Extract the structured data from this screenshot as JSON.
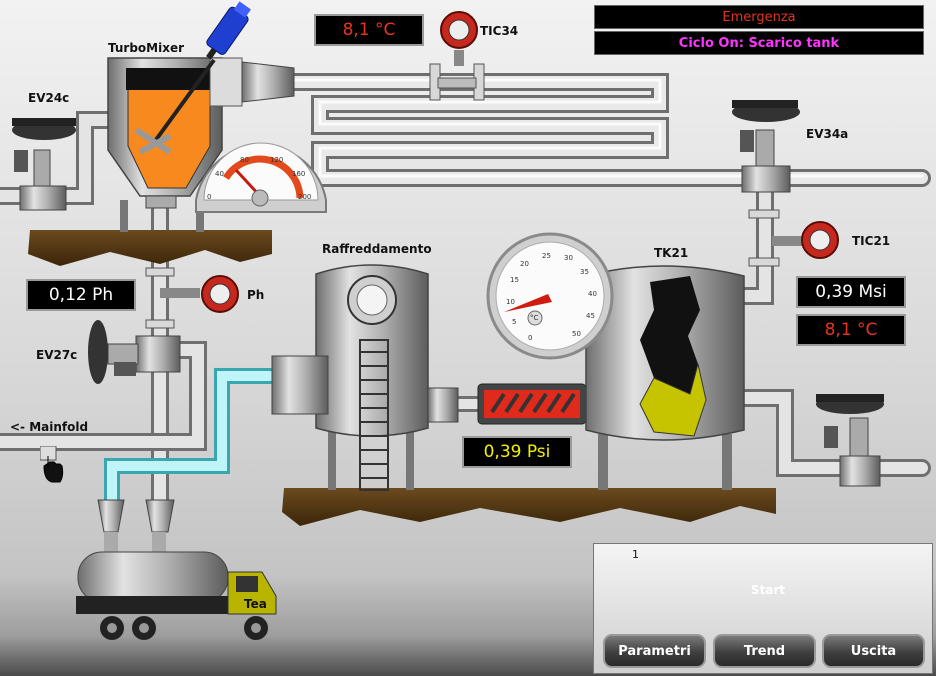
{
  "alarm": {
    "emergency": "Emergenza",
    "cycle": "Ciclo On: Scarico tank"
  },
  "labels": {
    "turbomixer": "TurboMixer",
    "tic34": "TIC34",
    "ev24c": "EV24c",
    "ev34a": "EV34a",
    "tic21": "TIC21",
    "ph": "Ph",
    "ev27c": "EV27c",
    "raffreddamento": "Raffreddamento",
    "tk21": "TK21",
    "mainfold": "<- Mainfold",
    "truck": "Tea"
  },
  "readouts": {
    "tic34_temp": "8,1 °C",
    "ph_value": "0,12 Ph",
    "tk21_msi": "0,39 Msi",
    "tk21_temp": "8,1 °C",
    "pump_psi": "0,39 Psi"
  },
  "mixer_gauge": {
    "ticks": [
      "0",
      "40",
      "80",
      "120",
      "160",
      "200"
    ]
  },
  "tank_gauge": {
    "ticks": [
      "0",
      "5",
      "10",
      "15",
      "20",
      "25",
      "30",
      "35",
      "40",
      "45",
      "50"
    ],
    "unit": "°C"
  },
  "controls": {
    "selector_position": "1",
    "start": "Start",
    "parametri": "Parametri",
    "trend": "Trend",
    "uscita": "Uscita"
  },
  "colors": {
    "pipe": "#c9c9c9",
    "coolant": "#8fe3ea",
    "product": "#f7891e",
    "tank_fill": "#c6c400",
    "alarm_red": "#e8341c",
    "readout_yellow": "#f3f000",
    "cycle_magenta": "#ff33ff"
  }
}
